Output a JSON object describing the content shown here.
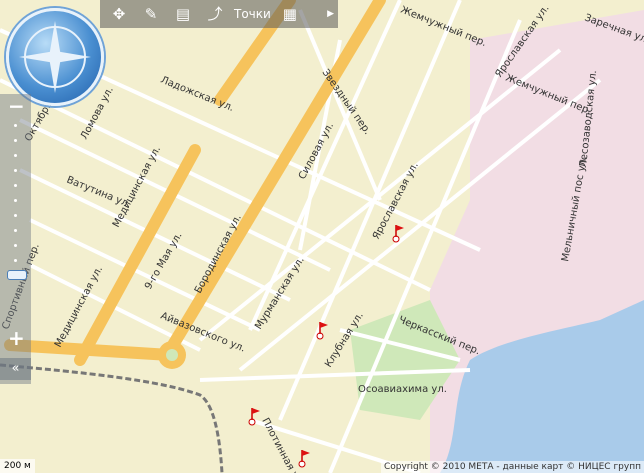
{
  "toolbar": {
    "points_label": "Точки",
    "buttons": [
      "move-icon",
      "ruler-icon",
      "measure-icon",
      "route-icon",
      "print-icon"
    ]
  },
  "map": {
    "streets": [
      "Ладожская ул.",
      "Звездный пер.",
      "Ломова ул.",
      "Ватутина ул.",
      "Медицинская ул.",
      "Октябрьская ул.",
      "Бородинская ул.",
      "Силовая ул.",
      "Ярославская ул.",
      "Ярославская ул.",
      "Мурманская ул.",
      "9-го Мая ул.",
      "Айвазовского ул.",
      "Медицинская ул.",
      "Клубная ул.",
      "Черкасский пер.",
      "Осоавиахима ул.",
      "Плотинная ул.",
      "Мельничный пос ул.",
      "Лесозаводская ул.",
      "Заречная ул.",
      "Спортивный пер.",
      "Жемчужный пер.",
      "Жемчужный пер."
    ],
    "colors": {
      "background": "#f3efcf",
      "main_road": "#f6c35c",
      "minor_road": "#ffffff",
      "water": "#a9cbea",
      "industrial": "#f2dde4",
      "park": "#cfe8b9"
    }
  },
  "scale": {
    "label": "200 м"
  },
  "copyright": {
    "text": "Copyright © 2010 МЕТА - данные карт © НИЦЕС групп"
  }
}
